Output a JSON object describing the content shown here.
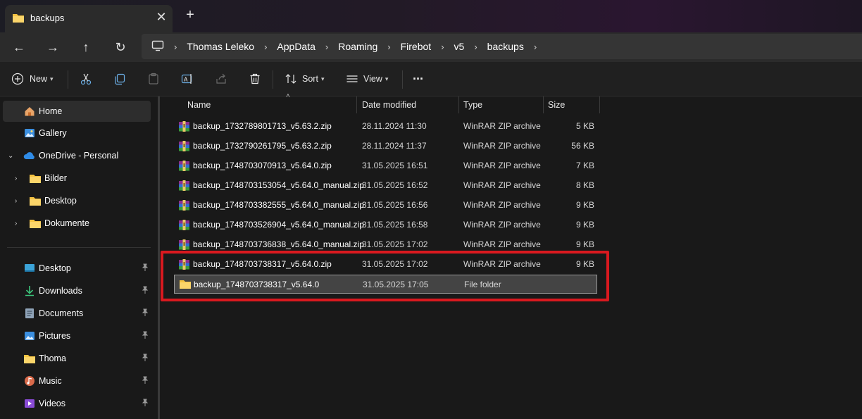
{
  "window": {
    "tab_title": "backups",
    "tab_close": "✕",
    "new_tab": "+"
  },
  "nav": {
    "back": "←",
    "forward": "→",
    "up": "↑",
    "refresh": "↻"
  },
  "breadcrumbs": [
    "Thomas Leleko",
    "AppData",
    "Roaming",
    "Firebot",
    "v5",
    "backups"
  ],
  "toolbar": {
    "new_label": "New",
    "sort_label": "Sort",
    "view_label": "View",
    "more_label": "···"
  },
  "sidebar": {
    "home": "Home",
    "gallery": "Gallery",
    "onedrive": "OneDrive - Personal",
    "onedrive_children": [
      "Bilder",
      "Desktop",
      "Dokumente"
    ],
    "quick_access": [
      "Desktop",
      "Downloads",
      "Documents",
      "Pictures",
      "Thoma",
      "Music",
      "Videos"
    ]
  },
  "columns": {
    "name": "Name",
    "date": "Date modified",
    "type": "Type",
    "size": "Size"
  },
  "files": [
    {
      "name": "backup_1732789801713_v5.63.2.zip",
      "date": "28.11.2024 11:30",
      "type": "WinRAR ZIP archive",
      "size": "5 KB"
    },
    {
      "name": "backup_1732790261795_v5.63.2.zip",
      "date": "28.11.2024 11:37",
      "type": "WinRAR ZIP archive",
      "size": "56 KB"
    },
    {
      "name": "backup_1748703070913_v5.64.0.zip",
      "date": "31.05.2025 16:51",
      "type": "WinRAR ZIP archive",
      "size": "7 KB"
    },
    {
      "name": "backup_1748703153054_v5.64.0_manual.zip",
      "date": "31.05.2025 16:52",
      "type": "WinRAR ZIP archive",
      "size": "8 KB"
    },
    {
      "name": "backup_1748703382555_v5.64.0_manual.zip",
      "date": "31.05.2025 16:56",
      "type": "WinRAR ZIP archive",
      "size": "9 KB"
    },
    {
      "name": "backup_1748703526904_v5.64.0_manual.zip",
      "date": "31.05.2025 16:58",
      "type": "WinRAR ZIP archive",
      "size": "9 KB"
    },
    {
      "name": "backup_1748703736838_v5.64.0_manual.zip",
      "date": "31.05.2025 17:02",
      "type": "WinRAR ZIP archive",
      "size": "9 KB"
    },
    {
      "name": "backup_1748703738317_v5.64.0.zip",
      "date": "31.05.2025 17:02",
      "type": "WinRAR ZIP archive",
      "size": "9 KB"
    },
    {
      "name": "backup_1748703738317_v5.64.0",
      "date": "31.05.2025 17:05",
      "type": "File folder",
      "size": ""
    }
  ],
  "colors": {
    "highlight_border": "#d9191f",
    "folder_yellow": "#f5c342",
    "selection_bg": "#444444"
  }
}
